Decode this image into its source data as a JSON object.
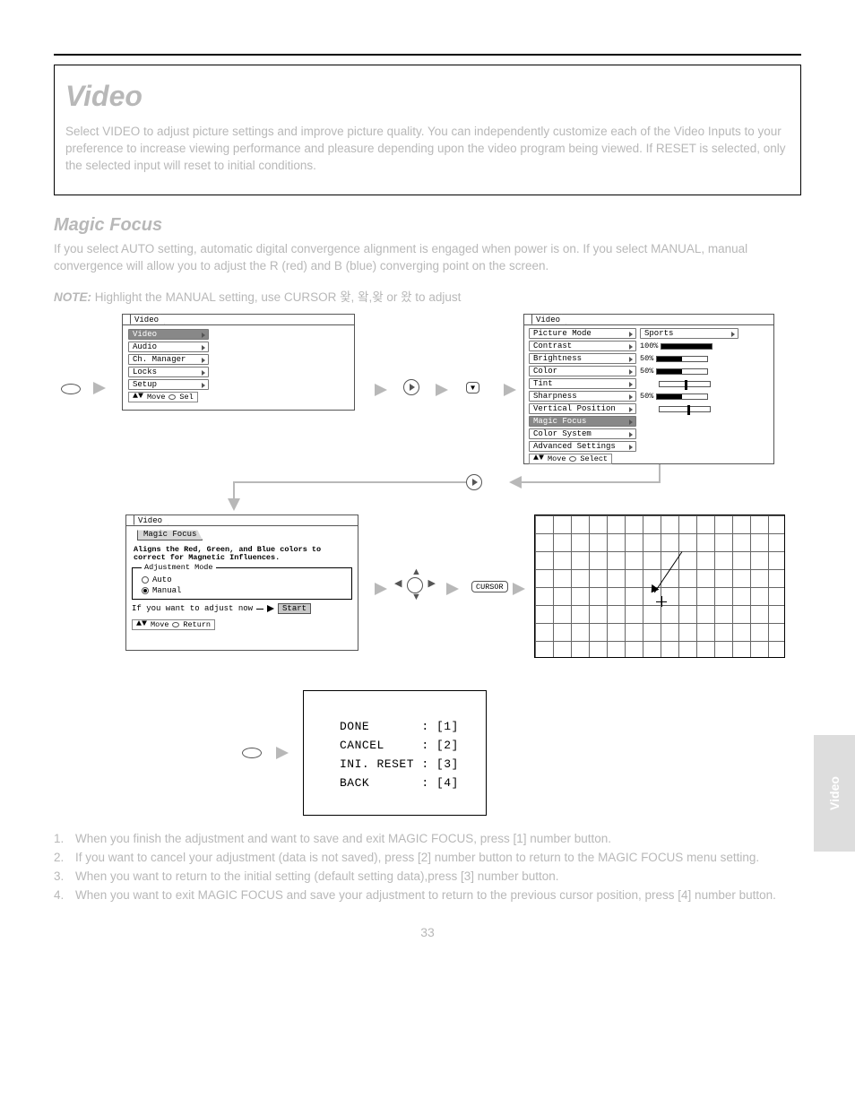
{
  "page": {
    "number": "33"
  },
  "sidetab": "Video",
  "header": {
    "title": "Video",
    "intro1": "Select VIDEO to adjust picture settings and improve picture quality. You can independently customize each of the Video Inputs to your preference to increase viewing performance and pleasure depending upon the video program being viewed. If RESET is selected, only the selected input will reset to initial conditions."
  },
  "magic_focus": {
    "title": "Magic Focus",
    "paragraph": "If you select AUTO setting, automatic digital convergence alignment is engaged when power is on. If you select MANUAL, manual convergence will allow you to adjust the R (red) and B (blue) converging point on the screen.",
    "note_label": "NOTE:",
    "note_text": "Highlight the MANUAL setting, use CURSOR 왗, 왘,왖 or 왔 to adjust"
  },
  "menu1": {
    "tab": "Video",
    "items": [
      "Video",
      "Audio",
      "Ch. Manager",
      "Locks",
      "Setup"
    ],
    "footer_move": "Move",
    "footer_sel": "Sel"
  },
  "menu2": {
    "tab": "Video",
    "rows": [
      {
        "label": "Picture Mode",
        "type": "chev",
        "value": "Sports"
      },
      {
        "label": "Contrast",
        "type": "bar",
        "value": "100%",
        "fill": 100
      },
      {
        "label": "Brightness",
        "type": "bar",
        "value": "50%",
        "fill": 50
      },
      {
        "label": "Color",
        "type": "bar",
        "value": "50%",
        "fill": 50
      },
      {
        "label": "Tint",
        "type": "tick",
        "pos": 50
      },
      {
        "label": "Sharpness",
        "type": "bar",
        "value": "50%",
        "fill": 50
      },
      {
        "label": "Vertical Position",
        "type": "tick",
        "pos": 55
      },
      {
        "label": "Magic Focus",
        "type": "dark"
      },
      {
        "label": "Color System",
        "type": "chev-only"
      },
      {
        "label": "Advanced Settings",
        "type": "chev-only"
      }
    ],
    "footer_move": "Move",
    "footer_select": "Select"
  },
  "focus_panel": {
    "tab": "Video",
    "subtab": "Magic Focus",
    "desc": "Aligns the Red, Green, and Blue colors to correct for Magnetic Influences.",
    "legend": "Adjustment Mode",
    "opt_auto": "Auto",
    "opt_manual": "Manual",
    "start_label": "If you want to adjust now",
    "start_btn": "Start",
    "footer_move": "Move",
    "footer_return": "Return"
  },
  "key_cursor": "CURSOR",
  "opt_box": {
    "done": "DONE",
    "cancel": "CANCEL",
    "inireset": "INI. RESET",
    "back": "BACK",
    "k1": "[1]",
    "k2": "[2]",
    "k3": "[3]",
    "k4": "[4]"
  },
  "steps": {
    "s1": "When you finish the adjustment and want to save and exit MAGIC FOCUS, press [1] number button.",
    "s2": "If you want to cancel your adjustment (data is not saved), press [2] number button to return to the MAGIC FOCUS menu setting.",
    "s3": "When you want to return to the initial setting (default setting data),press [3] number button.",
    "s4": "When you want to exit MAGIC FOCUS and save your adjustment to return to the previous cursor position, press [4]  number button."
  }
}
